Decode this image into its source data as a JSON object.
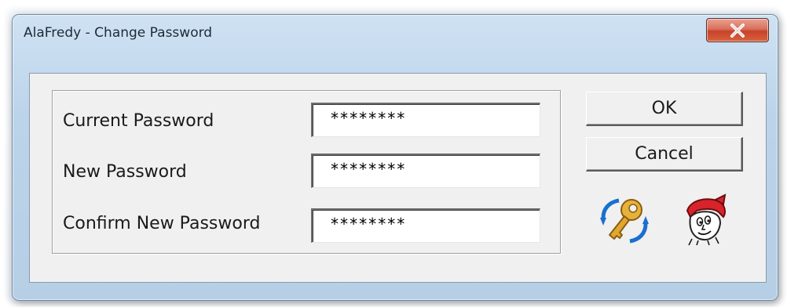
{
  "window": {
    "title": "AlaFredy - Change Password",
    "close_label": "X"
  },
  "form": {
    "fields": [
      {
        "label": "Current Password",
        "value": "********"
      },
      {
        "label": "New Password",
        "value": "********"
      },
      {
        "label": "Confirm New Password",
        "value": "********"
      }
    ]
  },
  "buttons": {
    "ok": "OK",
    "cancel": "Cancel"
  },
  "icons": {
    "refresh_key": "key-refresh-icon",
    "mascot": "mascot-icon"
  },
  "colors": {
    "title_bar": "#bcd4ea",
    "close_button": "#c7422a",
    "client_bg": "#f0f0f0"
  }
}
